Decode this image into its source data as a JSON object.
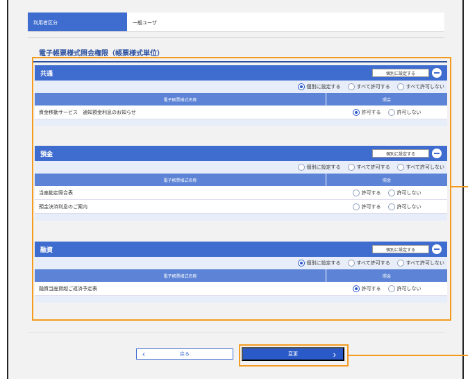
{
  "user_info": {
    "label": "利用者区分",
    "value": "一般ユーザ"
  },
  "section_title": "電子帳票様式照会権限（帳票様式単位）",
  "groups": [
    {
      "title": "共通",
      "button_label": "個別に設定する",
      "options": [
        "個別に設定する",
        "すべて許可する",
        "すべて許可しない"
      ],
      "selected_option": 0,
      "col_name": "電子帳票様式名称",
      "col_access": "照会",
      "rows": [
        {
          "name": "資金移動サービス　通知預金利息のお知らせ",
          "allow": "許可する",
          "deny": "許可しない",
          "selected": "allow"
        }
      ]
    },
    {
      "title": "預金",
      "button_label": "個別に設定する",
      "options": [
        "個別に設定する",
        "すべて許可する",
        "すべて許可しない"
      ],
      "selected_option": null,
      "col_name": "電子帳票様式名称",
      "col_access": "照会",
      "rows": [
        {
          "name": "当座勘定照合表",
          "allow": "許可する",
          "deny": "許可しない",
          "selected": null
        },
        {
          "name": "預金決済利息のご案内",
          "allow": "許可する",
          "deny": "許可しない",
          "selected": null
        }
      ]
    },
    {
      "title": "融資",
      "button_label": "個別に設定する",
      "options": [
        "個別に設定する",
        "すべて許可する",
        "すべて許可しない"
      ],
      "selected_option": 0,
      "col_name": "電子帳票様式名称",
      "col_access": "照会",
      "rows": [
        {
          "name": "融資当座貸越ご返済予定表",
          "allow": "許可する",
          "deny": "許可しない",
          "selected": "allow"
        }
      ]
    }
  ],
  "buttons": {
    "back": "戻る",
    "change": "変更"
  },
  "colors": {
    "primary": "#3e6ccf",
    "header_light": "#5c83d6",
    "highlight": "#f39a1f",
    "panel_bg": "#e8eef9"
  }
}
